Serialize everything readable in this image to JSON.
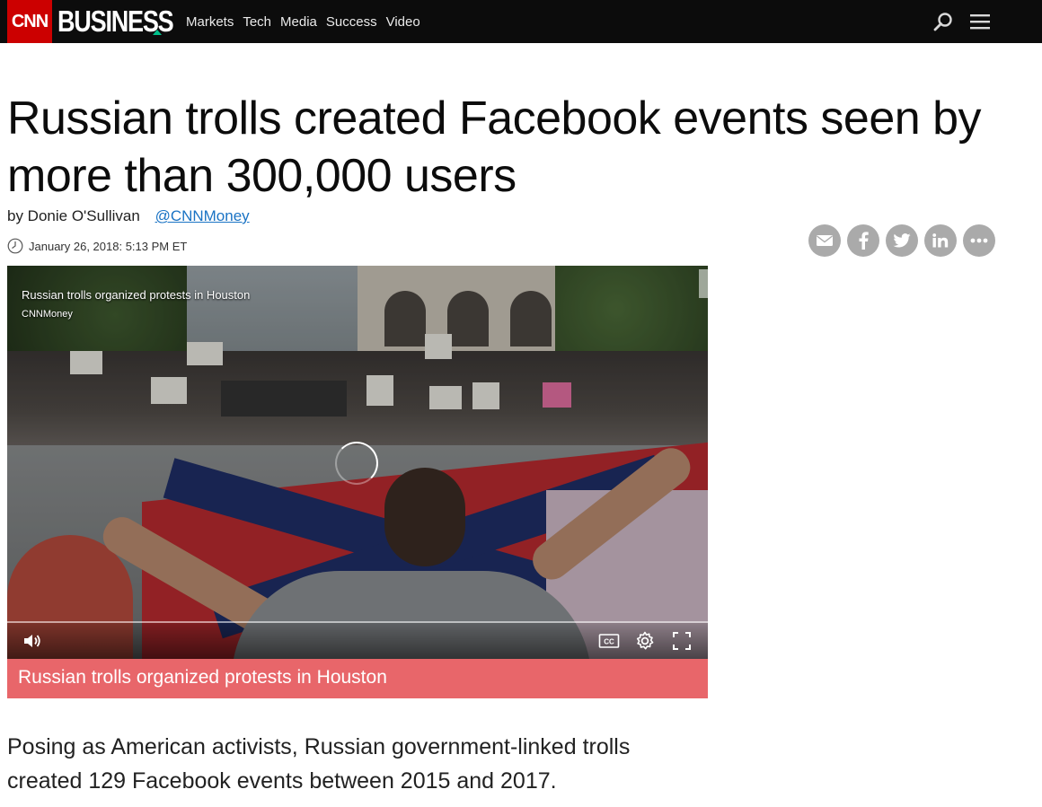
{
  "header": {
    "logo_text": "CNN",
    "section_logo": "BUSINESS",
    "nav": [
      "Markets",
      "Tech",
      "Media",
      "Success",
      "Video"
    ],
    "icons": {
      "search": "search-icon",
      "menu": "hamburger-menu-icon"
    },
    "colors": {
      "brand_red": "#cc0000",
      "bar": "#0c0c0c",
      "accent": "#00c08b"
    }
  },
  "article": {
    "headline": "Russian trolls created Facebook events seen by more than 300,000 users",
    "byline_prefix": "by Donie O'Sullivan",
    "byline_handle": "@CNNMoney",
    "date": "January 26, 2018: 5:13 PM ET",
    "lead": "Posing as American activists, Russian government-linked trolls created 129 Facebook events between 2015 and 2017."
  },
  "share": {
    "buttons": [
      "email-icon",
      "facebook-icon",
      "twitter-icon",
      "linkedin-icon",
      "more-icon"
    ]
  },
  "video": {
    "title": "Russian trolls organized protests in Houston",
    "source": "CNNMoney",
    "caption": "Russian trolls organized protests in Houston",
    "caption_color": "#e8666a",
    "state": "loading",
    "controls": [
      "volume-icon",
      "closed-captions-icon",
      "settings-gear-icon",
      "fullscreen-icon"
    ]
  }
}
